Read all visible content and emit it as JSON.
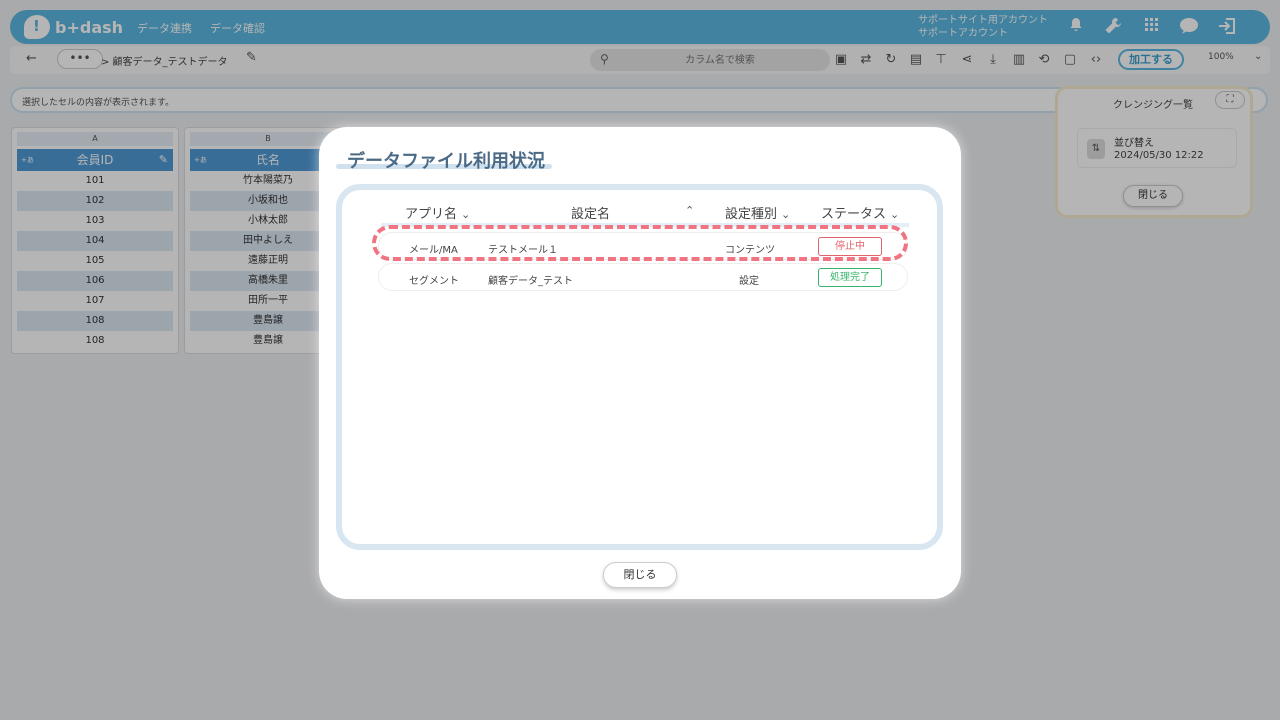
{
  "header": {
    "logo_text": "b+dash",
    "nav": [
      "データ連携",
      "データ確認"
    ],
    "account_line1": "サポートサイト用アカウント",
    "account_line2": "サポートアカウント",
    "icons": [
      "bell-icon",
      "wrench-icon",
      "apps-grid-icon",
      "chat-icon",
      "logout-icon"
    ]
  },
  "toolbar": {
    "back_glyph": "←",
    "more_glyph": "•••",
    "breadcrumb": "> 顧客データ_テストデータ",
    "search_placeholder": "カラム名で検索",
    "process_label": "加工する",
    "zoom": "100%"
  },
  "cell_bar": {
    "placeholder": "選択したセルの内容が表示されます。"
  },
  "table": {
    "columns": [
      {
        "letter": "A",
        "header": "会員ID",
        "tag": "+あ",
        "values": [
          "101",
          "102",
          "103",
          "104",
          "105",
          "106",
          "107",
          "108",
          "108"
        ]
      },
      {
        "letter": "B",
        "header": "氏名",
        "tag": "+あ",
        "values": [
          "竹本陽菜乃",
          "小坂和也",
          "小林太郎",
          "田中よしえ",
          "遠藤正明",
          "高橋朱里",
          "田所一平",
          "豊島譲",
          "豊島譲"
        ]
      }
    ]
  },
  "cleansing_panel": {
    "title": "クレンジング一覧",
    "item_name": "並び替え",
    "item_date": "2024/05/30 12:22",
    "close_label": "閉じる"
  },
  "modal": {
    "title": "データファイル利用状況",
    "columns": {
      "app": "アプリ名",
      "setting": "設定名",
      "kind": "設定種別",
      "status": "ステータス"
    },
    "rows": [
      {
        "app": "メール/MA",
        "setting": "テストメール１",
        "kind": "コンテンツ",
        "status": "停止中",
        "status_color": "#e0626a"
      },
      {
        "app": "セグメント",
        "setting": "顧客データ_テスト",
        "kind": "設定",
        "status": "処理完了",
        "status_color": "#39b46b"
      }
    ],
    "close_label": "閉じる"
  }
}
